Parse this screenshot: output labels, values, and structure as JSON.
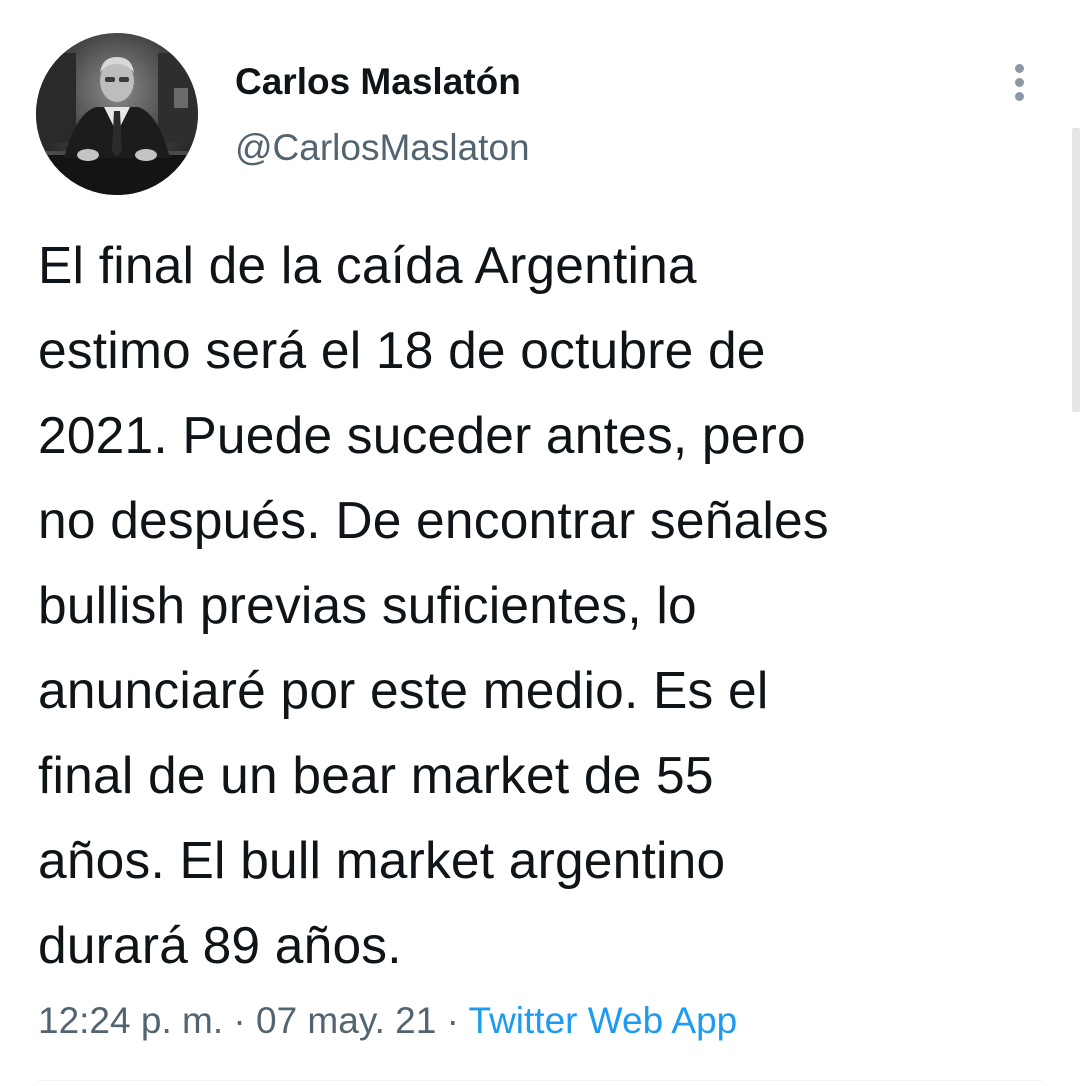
{
  "author": {
    "display_name": "Carlos Maslatón",
    "handle": "@CarlosMaslaton",
    "avatar": "author-avatar-photo"
  },
  "menu": {
    "icon": "more-vertical-icon"
  },
  "tweet": {
    "lines": [
      "El final de la caída Argentina",
      "estimo será el 18 de octubre de",
      "2021. Puede suceder antes, pero",
      "no después. De encontrar señales",
      "bullish previas suficientes, lo",
      "anunciaré por este medio. Es el",
      "final de un bear market de 55",
      "años. El bull market argentino",
      "durará 89 años."
    ]
  },
  "meta": {
    "time": "12:24 p. m.",
    "separator": " · ",
    "date": "07 may. 21",
    "source": "Twitter Web App"
  },
  "colors": {
    "text_primary": "#0f1419",
    "text_secondary": "#536471",
    "link": "#1d9bf0"
  }
}
